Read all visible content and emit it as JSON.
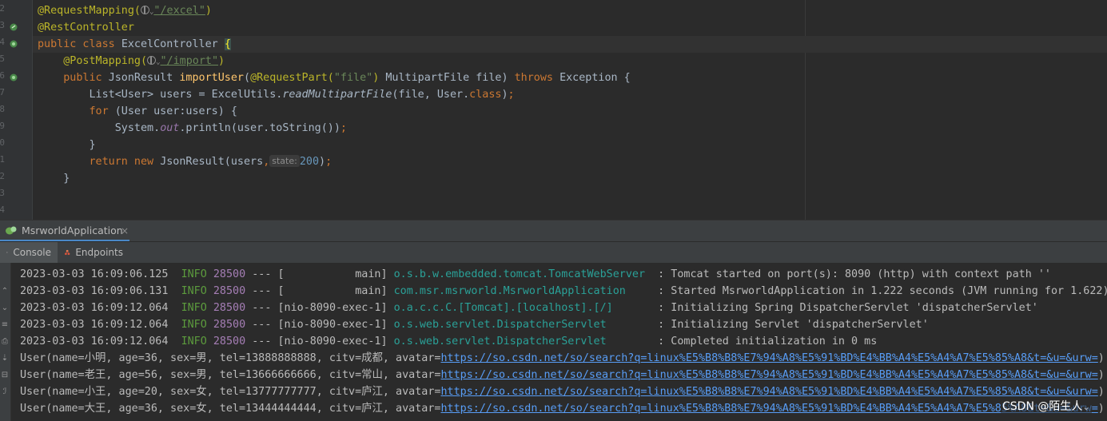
{
  "editor": {
    "line_numbers": [
      "2",
      "3",
      "4",
      "5",
      "6",
      "7",
      "8",
      "9",
      "0",
      "1",
      "2",
      "3",
      "4"
    ],
    "lines": [
      {
        "parts": [
          [
            "ann",
            "@RequestMapping("
          ],
          [
            "globe",
            ""
          ],
          [
            "caret",
            "⌄"
          ],
          [
            "strlink",
            "\"/excel\""
          ],
          [
            "ann",
            ")"
          ]
        ]
      },
      {
        "parts": [
          [
            "ann",
            "@RestController"
          ]
        ]
      },
      {
        "parts": [
          [
            "kw",
            "public class "
          ],
          [
            "plain",
            "ExcelController "
          ],
          [
            "brace",
            "{"
          ]
        ]
      },
      {
        "parts": [
          [
            "plain",
            "    "
          ],
          [
            "ann",
            "@PostMapping("
          ],
          [
            "globe",
            ""
          ],
          [
            "caret",
            "⌄"
          ],
          [
            "strlink",
            "\"/import\""
          ],
          [
            "ann",
            ")"
          ]
        ]
      },
      {
        "parts": [
          [
            "plain",
            "    "
          ],
          [
            "kw",
            "public "
          ],
          [
            "plain",
            "JsonResult "
          ],
          [
            "fn",
            "importUser"
          ],
          [
            "plain",
            "("
          ],
          [
            "ann",
            "@RequestPart("
          ],
          [
            "str",
            "\"file\""
          ],
          [
            "ann",
            ")"
          ],
          [
            "plain",
            " MultipartFile file) "
          ],
          [
            "kw",
            "throws "
          ],
          [
            "plain",
            "Exception {"
          ]
        ]
      },
      {
        "parts": [
          [
            "plain",
            "        List<User> users = ExcelUtils."
          ],
          [
            "it",
            "readMultipartFile"
          ],
          [
            "plain",
            "(file, User."
          ],
          [
            "kw",
            "class"
          ],
          [
            "plain",
            ")"
          ],
          [
            "kw",
            ";"
          ]
        ]
      },
      {
        "parts": [
          [
            "plain",
            "        "
          ],
          [
            "kw",
            "for "
          ],
          [
            "plain",
            "(User user:users) {"
          ]
        ]
      },
      {
        "parts": [
          [
            "plain",
            "            System."
          ],
          [
            "field",
            "out"
          ],
          [
            "plain",
            ".println(user.toString())"
          ],
          [
            "kw",
            ";"
          ]
        ]
      },
      {
        "parts": [
          [
            "plain",
            "        }"
          ]
        ]
      },
      {
        "parts": [
          [
            "plain",
            "        "
          ],
          [
            "kw",
            "return new "
          ],
          [
            "plain",
            "JsonResult(users"
          ],
          [
            "kw",
            ","
          ],
          [
            "hint",
            "state:"
          ],
          [
            "num",
            "200"
          ],
          [
            "plain",
            ")"
          ],
          [
            "kw",
            ";"
          ]
        ]
      },
      {
        "parts": [
          [
            "plain",
            "    }"
          ]
        ]
      }
    ]
  },
  "run_window": {
    "tab_label": "MsrworldApplication",
    "close_label": "×",
    "tabs": [
      "Console",
      "Endpoints"
    ]
  },
  "console": {
    "lines": [
      {
        "time": "2023-03-03 16:09:06.125",
        "level": "INFO",
        "pid": "28500",
        "sep": " --- ",
        "thread": "[           main]",
        "logger": "o.s.b.w.embedded.tomcat.TomcatWebServer  ",
        "msg": ": Tomcat started on port(s): 8090 (http) with context path ''"
      },
      {
        "time": "2023-03-03 16:09:06.131",
        "level": "INFO",
        "pid": "28500",
        "sep": " --- ",
        "thread": "[           main]",
        "logger": "com.msr.msrworld.MsrworldApplication     ",
        "msg": ": Started MsrworldApplication in 1.222 seconds (JVM running for 1.622)"
      },
      {
        "time": "2023-03-03 16:09:12.064",
        "level": "INFO",
        "pid": "28500",
        "sep": " --- ",
        "thread": "[nio-8090-exec-1]",
        "logger": "o.a.c.c.C.[Tomcat].[localhost].[/]       ",
        "msg": ": Initializing Spring DispatcherServlet 'dispatcherServlet'"
      },
      {
        "time": "2023-03-03 16:09:12.064",
        "level": "INFO",
        "pid": "28500",
        "sep": " --- ",
        "thread": "[nio-8090-exec-1]",
        "logger": "o.s.web.servlet.DispatcherServlet        ",
        "msg": ": Initializing Servlet 'dispatcherServlet'"
      },
      {
        "time": "2023-03-03 16:09:12.064",
        "level": "INFO",
        "pid": "28500",
        "sep": " --- ",
        "thread": "[nio-8090-exec-1]",
        "logger": "o.s.web.servlet.DispatcherServlet        ",
        "msg": ": Completed initialization in 0 ms"
      }
    ],
    "users": [
      {
        "prefix": "User(name=小明, age=36, sex=男, tel=13888888888, citv=成都, avatar=",
        "link": "https://so.csdn.net/so/search?q=linux%E5%B8%B8%E7%94%A8%E5%91%BD%E4%BB%A4%E5%A4%A7%E5%85%A8&t=&u=&urw=",
        "suffix": ")"
      },
      {
        "prefix": "User(name=老王, age=56, sex=男, tel=13666666666, citv=常山, avatar=",
        "link": "https://so.csdn.net/so/search?q=linux%E5%B8%B8%E7%94%A8%E5%91%BD%E4%BB%A4%E5%A4%A7%E5%85%A8&t=&u=&urw=",
        "suffix": ")"
      },
      {
        "prefix": "User(name=小王, age=20, sex=女, tel=13777777777, citv=庐江, avatar=",
        "link": "https://so.csdn.net/so/search?q=linux%E5%B8%B8%E7%94%A8%E5%91%BD%E4%BB%A4%E5%A4%A7%E5%85%A8&t=&u=&urw=",
        "suffix": ")"
      },
      {
        "prefix": "User(name=大王, age=36, sex=女, tel=13444444444, citv=庐江, avatar=",
        "link": "https://so.csdn.net/so/search?q=linux%E5%B8%B8%E7%94%A8%E5%91%BD%E4%BB%A4%E5%A4%A7%E5%85%A8&t=&u=&urw=",
        "suffix": ")"
      }
    ],
    "left_icons": [
      "⌃",
      "⌄",
      "≡",
      "⎙",
      "⇣",
      "⊟",
      "ℐ"
    ]
  },
  "watermark": {
    "text": "CSDN @陌生人",
    "caret": "⌄"
  },
  "colors": {
    "accent": "#4a88c7",
    "keyword": "#cc7832",
    "annotation": "#bbb529",
    "string": "#6a8759",
    "info": "#5c9b3d",
    "link": "#589df6"
  }
}
